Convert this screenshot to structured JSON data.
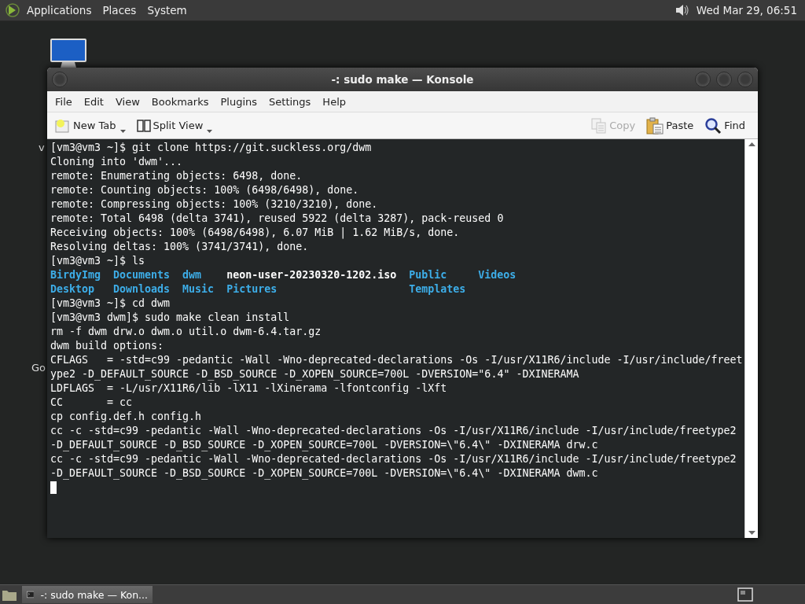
{
  "top_panel": {
    "menus": [
      "Applications",
      "Places",
      "System"
    ],
    "clock": "Wed Mar 29, 06:51"
  },
  "desktop": {
    "labels": [
      "v",
      "Go"
    ]
  },
  "window": {
    "title": "-: sudo make — Konsole",
    "menu": [
      "File",
      "Edit",
      "View",
      "Bookmarks",
      "Plugins",
      "Settings",
      "Help"
    ],
    "toolbar": [
      {
        "label": "New Tab",
        "kind": "newtab",
        "disabled": false,
        "dropdown": true
      },
      {
        "label": "Split View",
        "kind": "split",
        "disabled": false,
        "dropdown": true
      },
      {
        "label": "Copy",
        "kind": "copy",
        "disabled": true,
        "dropdown": false
      },
      {
        "label": "Paste",
        "kind": "paste",
        "disabled": false,
        "dropdown": false
      },
      {
        "label": "Find",
        "kind": "find",
        "disabled": false,
        "dropdown": false
      }
    ],
    "terminal": [
      {
        "kind": "text",
        "text": "[vm3@vm3 ~]$ git clone https://git.suckless.org/dwm"
      },
      {
        "kind": "text",
        "text": "Cloning into 'dwm'..."
      },
      {
        "kind": "text",
        "text": "remote: Enumerating objects: 6498, done."
      },
      {
        "kind": "text",
        "text": "remote: Counting objects: 100% (6498/6498), done."
      },
      {
        "kind": "text",
        "text": "remote: Compressing objects: 100% (3210/3210), done."
      },
      {
        "kind": "text",
        "text": "remote: Total 6498 (delta 3741), reused 5922 (delta 3287), pack-reused 0"
      },
      {
        "kind": "text",
        "text": "Receiving objects: 100% (6498/6498), 6.07 MiB | 1.62 MiB/s, done."
      },
      {
        "kind": "text",
        "text": "Resolving deltas: 100% (3741/3741), done."
      },
      {
        "kind": "text",
        "text": "[vm3@vm3 ~]$ ls"
      },
      {
        "kind": "ls",
        "entries": [
          {
            "text": "BirdyImg",
            "color": "#3daee9"
          },
          {
            "text": "Desktop",
            "color": "#3daee9"
          },
          {
            "text": "Documents",
            "color": "#3daee9"
          },
          {
            "text": "Downloads",
            "color": "#3daee9"
          },
          {
            "text": "dwm",
            "color": "#3daee9"
          },
          {
            "text": "Music",
            "color": "#3daee9"
          },
          {
            "text": "neon-user-20230320-1202.iso",
            "color": "#fcfcfc"
          },
          {
            "text": "Pictures",
            "color": "#3daee9"
          },
          {
            "text": "Public",
            "color": "#3daee9"
          },
          {
            "text": "Templates",
            "color": "#3daee9"
          },
          {
            "text": "Videos",
            "color": "#3daee9"
          }
        ]
      },
      {
        "kind": "text",
        "text": "[vm3@vm3 ~]$ cd dwm"
      },
      {
        "kind": "text",
        "text": "[vm3@vm3 dwm]$ sudo make clean install"
      },
      {
        "kind": "text",
        "text": "rm -f dwm drw.o dwm.o util.o dwm-6.4.tar.gz"
      },
      {
        "kind": "text",
        "text": "dwm build options:"
      },
      {
        "kind": "text",
        "text": "CFLAGS   = -std=c99 -pedantic -Wall -Wno-deprecated-declarations -Os -I/usr/X11R6/include -I/usr/include/freet"
      },
      {
        "kind": "text",
        "text": "ype2 -D_DEFAULT_SOURCE -D_BSD_SOURCE -D_XOPEN_SOURCE=700L -DVERSION=\"6.4\" -DXINERAMA"
      },
      {
        "kind": "text",
        "text": "LDFLAGS  = -L/usr/X11R6/lib -lX11 -lXinerama -lfontconfig -lXft"
      },
      {
        "kind": "text",
        "text": "CC       = cc"
      },
      {
        "kind": "text",
        "text": "cp config.def.h config.h"
      },
      {
        "kind": "text",
        "text": "cc -c -std=c99 -pedantic -Wall -Wno-deprecated-declarations -Os -I/usr/X11R6/include -I/usr/include/freetype2"
      },
      {
        "kind": "text",
        "text": "-D_DEFAULT_SOURCE -D_BSD_SOURCE -D_XOPEN_SOURCE=700L -DVERSION=\\\"6.4\\\" -DXINERAMA drw.c"
      },
      {
        "kind": "text",
        "text": "cc -c -std=c99 -pedantic -Wall -Wno-deprecated-declarations -Os -I/usr/X11R6/include -I/usr/include/freetype2"
      },
      {
        "kind": "text",
        "text": "-D_DEFAULT_SOURCE -D_BSD_SOURCE -D_XOPEN_SOURCE=700L -DVERSION=\\\"6.4\\\" -DXINERAMA dwm.c"
      },
      {
        "kind": "cursor"
      }
    ]
  },
  "taskbar": {
    "tasks": [
      {
        "label": "-: sudo make — Kon...",
        "selected": true
      }
    ]
  }
}
